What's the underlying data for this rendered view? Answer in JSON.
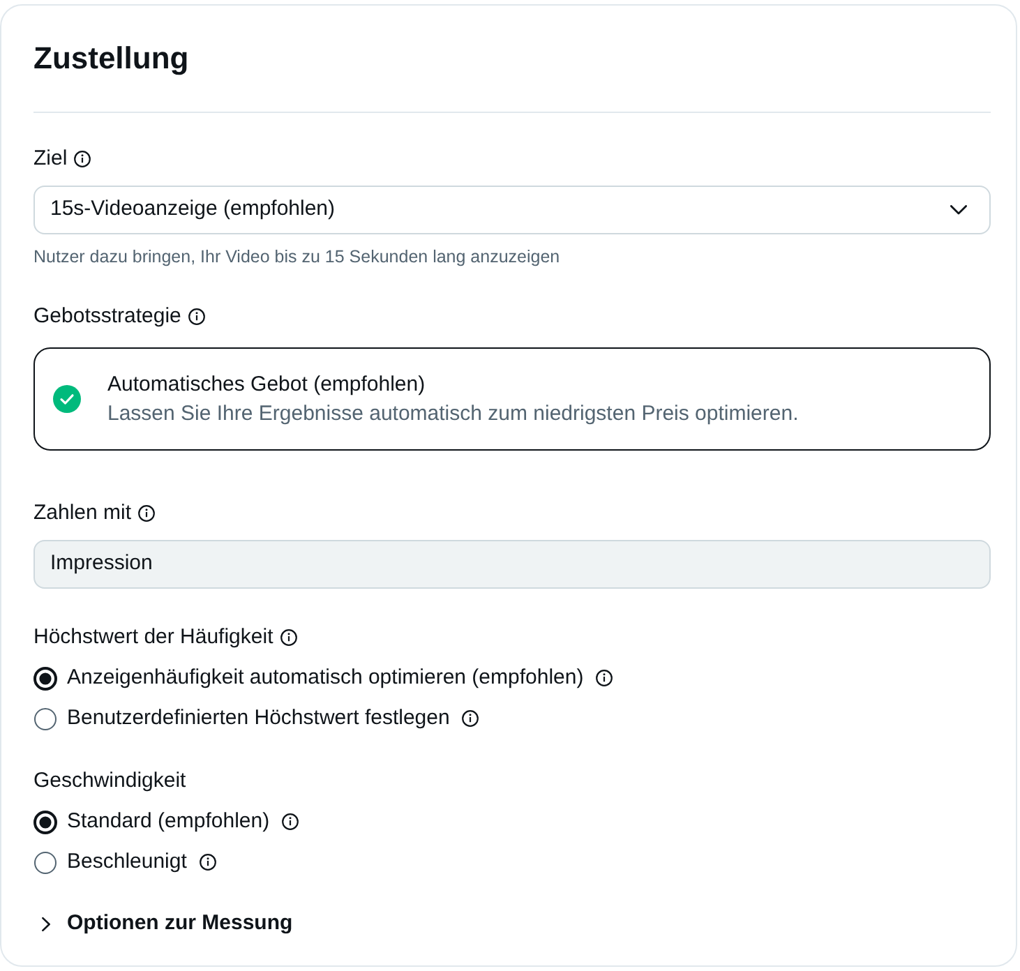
{
  "card": {
    "title": "Zustellung"
  },
  "sections": [
    {
      "kind": "select",
      "label": "Ziel",
      "info": true,
      "value": "15s-Videoanzeige (empfohlen)",
      "hint": "Nutzer dazu bringen, Ihr Video bis zu 15 Sekunden lang anzuzeigen"
    },
    {
      "kind": "choice_card",
      "label": "Gebotsstrategie",
      "info": true,
      "option": {
        "title": "Automatisches Gebot (empfohlen)",
        "description": "Lassen Sie Ihre Ergebnisse automatisch zum niedrigsten Preis optimieren.",
        "selected": true
      }
    },
    {
      "kind": "field",
      "label": "Zahlen mit",
      "info": true,
      "value": "Impression",
      "disabled": true
    },
    {
      "kind": "radio",
      "label": "Höchstwert der Häufigkeit",
      "info": true,
      "options": [
        {
          "label": "Anzeigenhäufigkeit automatisch optimieren (empfohlen)",
          "info": true,
          "selected": true
        },
        {
          "label": "Benutzerdefinierten Höchstwert festlegen",
          "info": true,
          "selected": false
        }
      ]
    },
    {
      "kind": "radio",
      "label": "Geschwindigkeit",
      "info": false,
      "options": [
        {
          "label": "Standard (empfohlen)",
          "info": true,
          "selected": true
        },
        {
          "label": "Beschleunigt",
          "info": true,
          "selected": false
        }
      ]
    }
  ],
  "expander": {
    "label": "Optionen zur Messung",
    "expanded": false
  }
}
